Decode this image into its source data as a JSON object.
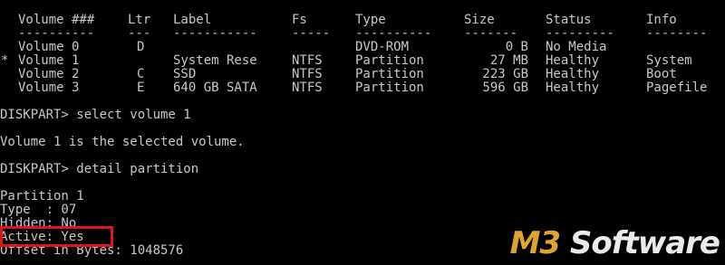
{
  "volume_table": {
    "headers": [
      "Volume ###",
      "Ltr",
      "Label",
      "Fs",
      "Type",
      "Size",
      "Status",
      "Info"
    ],
    "separators": [
      "----------",
      "---",
      "-----------",
      "-----",
      "----------",
      "-------",
      "---------",
      "--------"
    ],
    "rows": [
      {
        "marker": " ",
        "volume": "Volume 0",
        "ltr": "D",
        "label": "",
        "fs": "",
        "type": "DVD-ROM",
        "size": "0 B",
        "status": "No Media",
        "info": ""
      },
      {
        "marker": "*",
        "volume": "Volume 1",
        "ltr": "",
        "label": "System Rese",
        "fs": "NTFS",
        "type": "Partition",
        "size": "27 MB",
        "status": "Healthy",
        "info": "System"
      },
      {
        "marker": " ",
        "volume": "Volume 2",
        "ltr": "C",
        "label": "SSD",
        "fs": "NTFS",
        "type": "Partition",
        "size": "223 GB",
        "status": "Healthy",
        "info": "Boot"
      },
      {
        "marker": " ",
        "volume": "Volume 3",
        "ltr": "E",
        "label": "640 GB SATA",
        "fs": "NTFS",
        "type": "Partition",
        "size": "596 GB",
        "status": "Healthy",
        "info": "Pagefile"
      }
    ]
  },
  "session": {
    "command_1": "DISKPART> select volume 1",
    "result_1": "Volume 1 is the selected volume.",
    "command_2": "DISKPART> detail partition",
    "partition": "Partition 1",
    "type_line": "Type  : 07",
    "hidden_line": "Hidden: No",
    "active_line": "Active: Yes",
    "offset_line": "Offset in Bytes: 1048576"
  },
  "watermark": {
    "part1": "M3",
    "part2": " Software"
  },
  "colors": {
    "background": "#000000",
    "text": "#c8c8c8",
    "highlight_border": "#e0141c",
    "watermark_accent": "#f2b233"
  }
}
